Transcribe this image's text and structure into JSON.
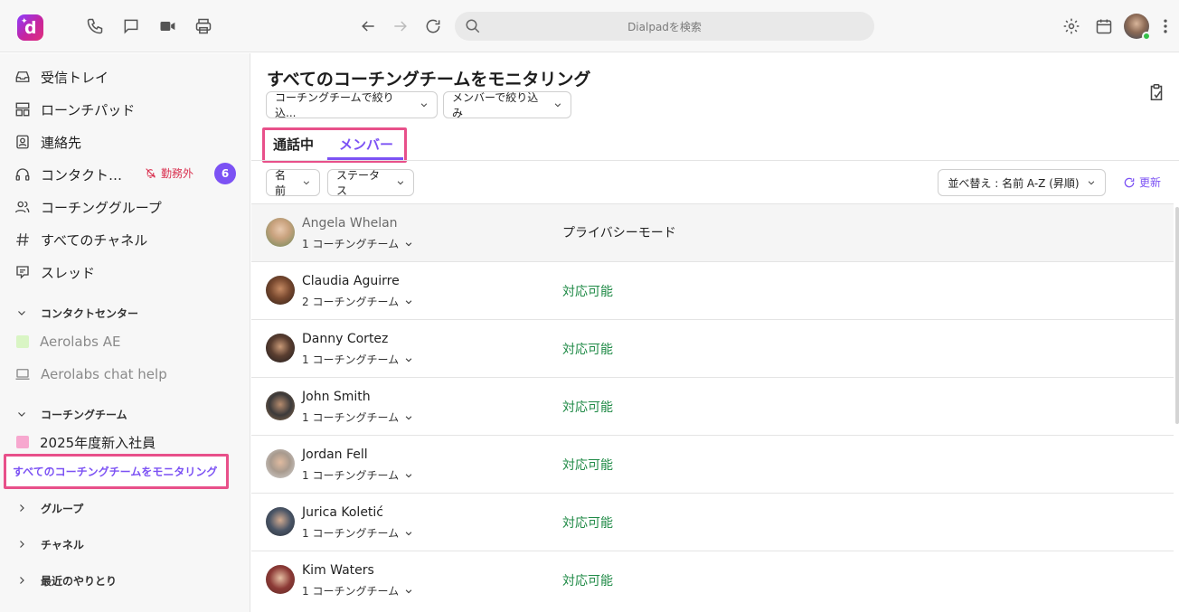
{
  "search": {
    "placeholder": "Dialpadを検索"
  },
  "sidebar": {
    "items": [
      {
        "label": "受信トレイ",
        "icon": "inbox-icon"
      },
      {
        "label": "ローンチパッド",
        "icon": "launchpad-icon"
      },
      {
        "label": "連絡先",
        "icon": "contacts-icon"
      },
      {
        "label": "コンタクト…",
        "icon": "headset-icon",
        "status": "勤務外",
        "badge": "6"
      },
      {
        "label": "コーチンググループ",
        "icon": "people-icon"
      },
      {
        "label": "すべてのチャネル",
        "icon": "hash-icon"
      },
      {
        "label": "スレッド",
        "icon": "threads-icon"
      }
    ],
    "contact_center": {
      "header": "コンタクトセンター",
      "items": [
        {
          "label": "Aerolabs AE",
          "color": "#d9f5c4"
        },
        {
          "label": "Aerolabs chat help"
        }
      ]
    },
    "coaching_team": {
      "header": "コーチングチーム",
      "items": [
        {
          "label": "2025年度新入社員",
          "color": "#f7a8cf"
        }
      ],
      "monitor_link": "すべてのコーチングチームをモニタリング"
    },
    "groups": "グループ",
    "channels": "チャネル",
    "recent": "最近のやりとり"
  },
  "main": {
    "title": "すべてのコーチングチームをモニタリング",
    "filters": {
      "coaching_team": "コーチングチームで絞り込...",
      "member": "メンバーで絞り込み"
    },
    "tabs": {
      "on_call": "通話中",
      "members": "メンバー"
    },
    "column_filters": {
      "name": "名前",
      "status": "ステータス"
    },
    "sort": "並べ替え : 名前 A-Z (昇順)",
    "refresh": "更新"
  },
  "members": [
    {
      "name": "Angela Whelan",
      "teams": "1 コーチングチーム",
      "status": "プライバシーモード",
      "avatar": "#c9a27e"
    },
    {
      "name": "Claudia Aguirre",
      "teams": "2 コーチングチーム",
      "status": "対応可能",
      "avatar": "#7a4a30"
    },
    {
      "name": "Danny Cortez",
      "teams": "1 コーチングチーム",
      "status": "対応可能",
      "avatar": "#5a3e30"
    },
    {
      "name": "John Smith",
      "teams": "1 コーチングチーム",
      "status": "対応可能",
      "avatar": "#3c3a3a"
    },
    {
      "name": "Jordan Fell",
      "teams": "1 コーチングチーム",
      "status": "対応可能",
      "avatar": "#a89a8e"
    },
    {
      "name": "Jurica Koletić",
      "teams": "1 コーチングチーム",
      "status": "対応可能",
      "avatar": "#4a5566"
    },
    {
      "name": "Kim Waters",
      "teams": "1 コーチングチーム",
      "status": "対応可能",
      "avatar": "#8c3a36"
    }
  ],
  "colors": {
    "accent": "#7c52f4",
    "available": "#1f8a46",
    "dnd": "#d9304f",
    "highlight": "#e8508a"
  }
}
